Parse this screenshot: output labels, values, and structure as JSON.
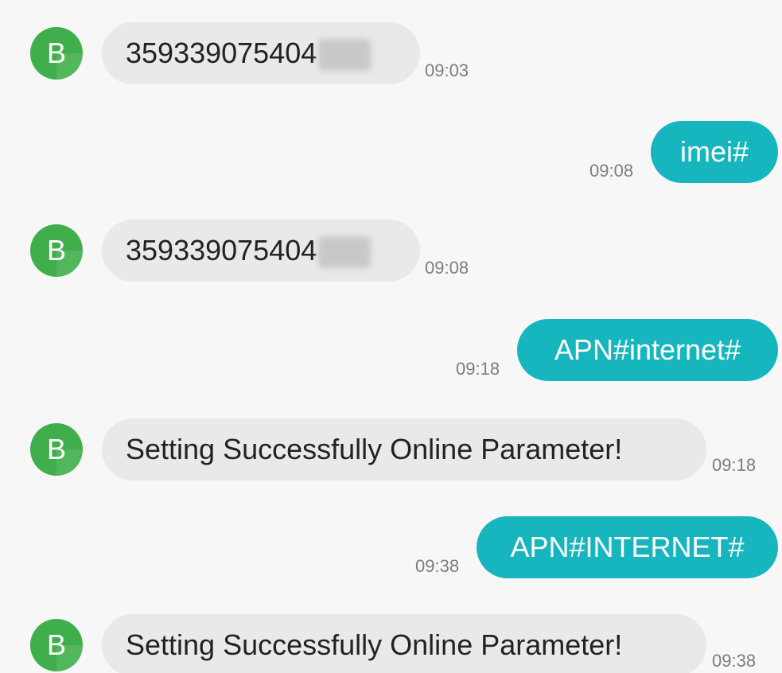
{
  "conversation": {
    "contact_initial": "B",
    "messages": [
      {
        "direction": "incoming",
        "text": "359339075404",
        "time": "09:03"
      },
      {
        "direction": "outgoing",
        "text": "imei#",
        "time": "09:08"
      },
      {
        "direction": "incoming",
        "text": "359339075404",
        "time": "09:08"
      },
      {
        "direction": "outgoing",
        "text": "APN#internet#",
        "time": "09:18"
      },
      {
        "direction": "incoming",
        "text": "Setting Successfully Online Parameter!",
        "time": "09:18"
      },
      {
        "direction": "outgoing",
        "text": "APN#INTERNET#",
        "time": "09:38"
      },
      {
        "direction": "incoming",
        "text": "Setting Successfully Online Parameter!",
        "time": "09:38"
      }
    ]
  },
  "colors": {
    "background": "#f7f7f7",
    "incoming_bubble": "#e9e9e9",
    "outgoing_bubble": "#17b6bf",
    "avatar": "#3fae4b",
    "timestamp": "#7d7d7d"
  },
  "icons": {
    "avatar": "letter-avatar-icon"
  }
}
